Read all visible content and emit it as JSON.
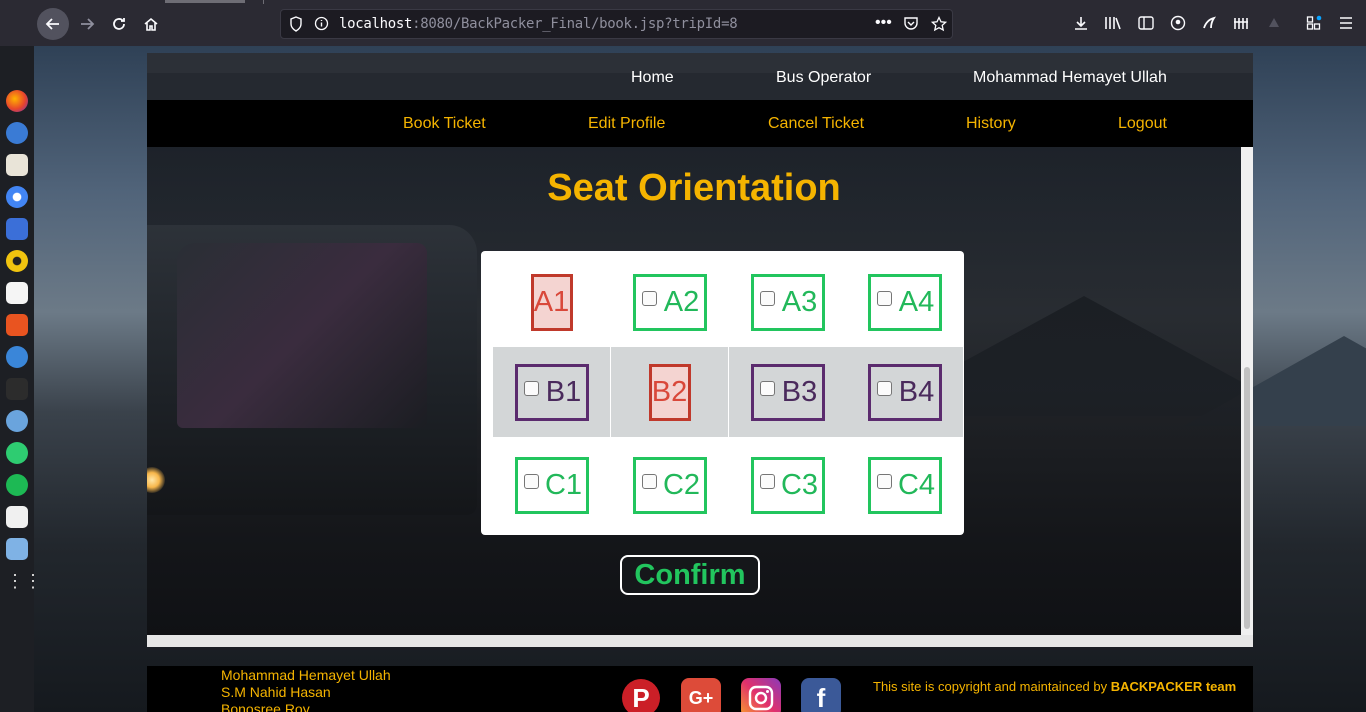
{
  "browser": {
    "url_host": "localhost",
    "url_rest": ":8080/BackPacker_Final/book.jsp?tripId=8"
  },
  "nav_top": {
    "home": "Home",
    "bus_operator": "Bus Operator",
    "user_name": "Mohammad Hemayet Ullah"
  },
  "nav_menu": {
    "book_ticket": "Book Ticket",
    "edit_profile": "Edit Profile",
    "cancel_ticket": "Cancel Ticket",
    "history": "History",
    "logout": "Logout"
  },
  "seats": {
    "title": "Seat Orientation",
    "rows": [
      [
        {
          "label": "A1",
          "status": "booked"
        },
        {
          "label": "A2",
          "status": "available"
        },
        {
          "label": "A3",
          "status": "available"
        },
        {
          "label": "A4",
          "status": "available"
        }
      ],
      [
        {
          "label": "B1",
          "status": "available"
        },
        {
          "label": "B2",
          "status": "booked"
        },
        {
          "label": "B3",
          "status": "available"
        },
        {
          "label": "B4",
          "status": "available"
        }
      ],
      [
        {
          "label": "C1",
          "status": "available"
        },
        {
          "label": "C2",
          "status": "available"
        },
        {
          "label": "C3",
          "status": "available"
        },
        {
          "label": "C4",
          "status": "available"
        }
      ]
    ],
    "confirm_label": "Confirm"
  },
  "footer": {
    "names": [
      "Mohammad Hemayet Ullah",
      "S.M Nahid Hasan",
      "Bonosree Roy"
    ],
    "copyright_prefix": "This site is copyright and maintainced by ",
    "copyright_team": "BACKPACKER team"
  },
  "colors": {
    "accent_gold": "#f5b400",
    "available_green": "#22c55e",
    "booked_red": "#c0392b",
    "row_b_purple": "#5b2b6e"
  }
}
